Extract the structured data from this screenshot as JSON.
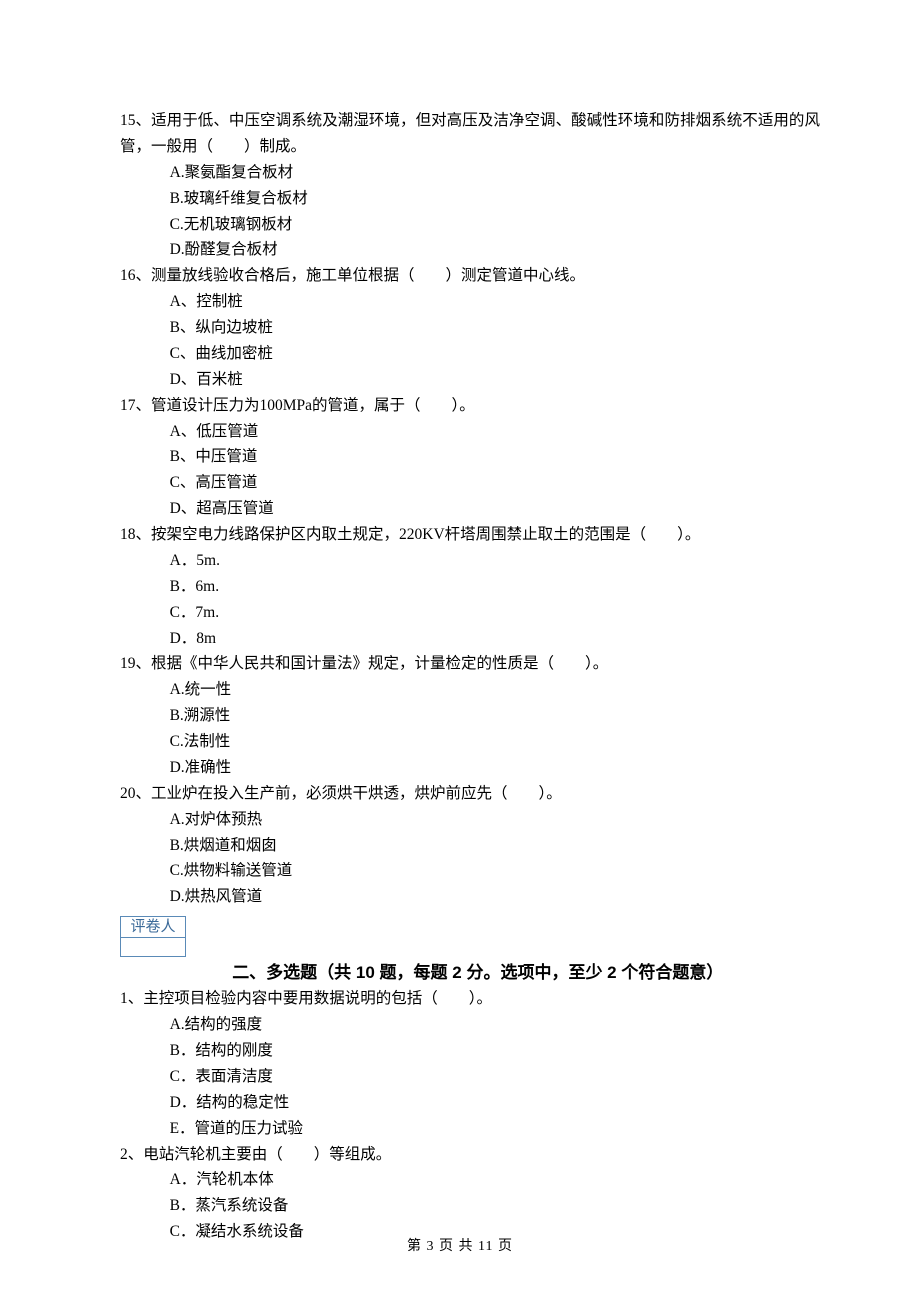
{
  "questions": [
    {
      "stem": "15、适用于低、中压空调系统及潮湿环境，但对高压及洁净空调、酸碱性环境和防排烟系统不适用的风管，一般用（　　）制成。",
      "opts": [
        "A.聚氨酯复合板材",
        "B.玻璃纤维复合板材",
        "C.无机玻璃钢板材",
        "D.酚醛复合板材"
      ]
    },
    {
      "stem": "16、测量放线验收合格后，施工单位根据（　　）测定管道中心线。",
      "opts": [
        "A、控制桩",
        "B、纵向边坡桩",
        "C、曲线加密桩",
        "D、百米桩"
      ]
    },
    {
      "stem": "17、管道设计压力为100MPa的管道，属于（　　）。",
      "opts": [
        "A、低压管道",
        "B、中压管道",
        "C、高压管道",
        "D、超高压管道"
      ]
    },
    {
      "stem": "18、按架空电力线路保护区内取土规定，220KV杆塔周围禁止取土的范围是（　　）。",
      "opts": [
        "A．5m.",
        "B．6m.",
        "C．7m.",
        "D．8m"
      ]
    },
    {
      "stem": "19、根据《中华人民共和国计量法》规定，计量检定的性质是（　　）。",
      "opts": [
        "A.统一性",
        "B.溯源性",
        "C.法制性",
        "D.准确性"
      ]
    },
    {
      "stem": "20、工业炉在投入生产前，必须烘干烘透，烘炉前应先（　　）。",
      "opts": [
        "A.对炉体预热",
        "B.烘烟道和烟囱",
        "C.烘物料输送管道",
        "D.烘热风管道"
      ]
    }
  ],
  "grader_label": "评卷人",
  "section_heading": "二、多选题（共 10 题，每题 2 分。选项中，至少 2 个符合题意）",
  "multi_questions": [
    {
      "stem": "1、主控项目检验内容中要用数据说明的包括（　　）。",
      "opts": [
        "A.结构的强度",
        "B．结构的刚度",
        "C．表面清洁度",
        "D．结构的稳定性",
        "E．管道的压力试验"
      ]
    },
    {
      "stem": "2、电站汽轮机主要由（　　）等组成。",
      "opts": [
        "A．汽轮机本体",
        "B．蒸汽系统设备",
        "C．凝结水系统设备"
      ]
    }
  ],
  "footer": "第 3 页 共 11 页"
}
